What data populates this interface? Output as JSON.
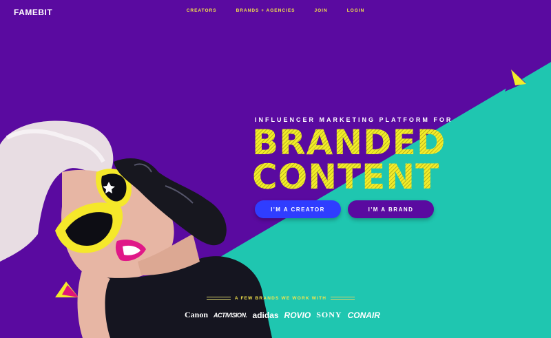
{
  "header": {
    "logo": "FAMEBIT",
    "nav": [
      "CREATORS",
      "BRANDS + AGENCIES",
      "JOIN",
      "LOGIN"
    ]
  },
  "hero": {
    "tagline": "INFLUENCER MARKETING PLATFORM FOR",
    "headline_line1": "BRANDED",
    "headline_line2": "CONTENT",
    "creator_button": "I'M A CREATOR",
    "brand_button": "I'M A BRAND"
  },
  "brands": {
    "title": "A FEW BRANDS WE WORK WITH",
    "logos": [
      "Canon",
      "ACTIVISION.",
      "adidas",
      "ROVIO",
      "SONY",
      "CONAIR"
    ]
  },
  "colors": {
    "purple": "#5a0aa0",
    "teal": "#1fc6b0",
    "yellow": "#f2ec2a",
    "blue_button": "#2f3dff"
  }
}
